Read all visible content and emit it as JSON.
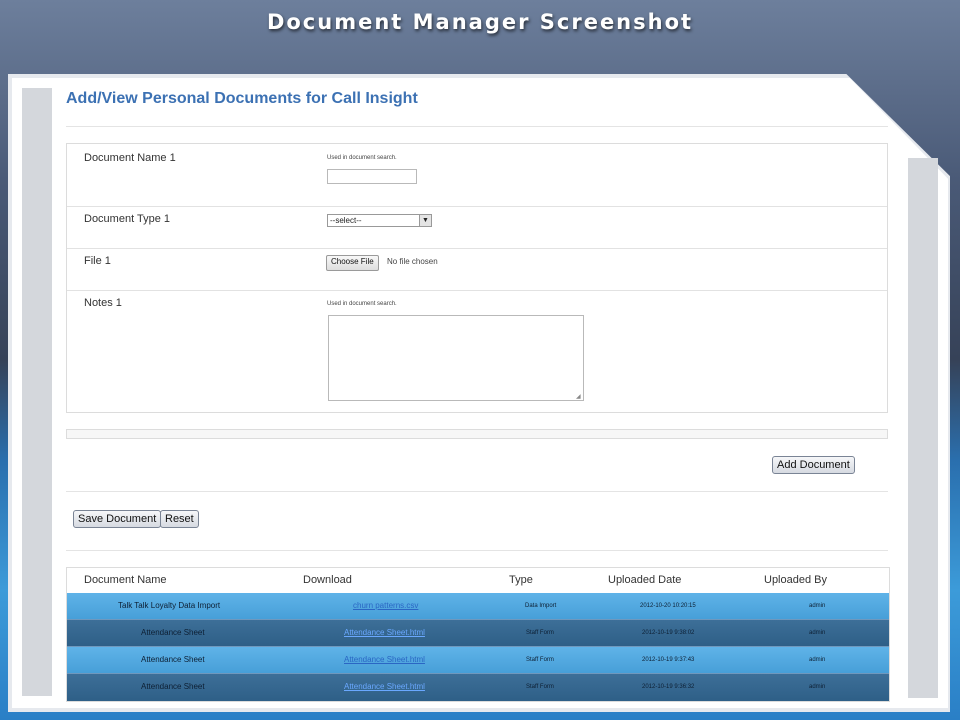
{
  "slide": {
    "title": "Document Manager Screenshot"
  },
  "page": {
    "heading": "Add/View Personal Documents for Call Insight"
  },
  "form": {
    "document_name": {
      "label": "Document Name 1",
      "hint": "Used in document search.",
      "value": ""
    },
    "document_type": {
      "label": "Document Type 1",
      "selected": "--select--"
    },
    "file": {
      "label": "File 1",
      "button_label": "Choose File",
      "status": "No file chosen"
    },
    "notes": {
      "label": "Notes 1",
      "hint": "Used in document search.",
      "value": ""
    }
  },
  "actions": {
    "add_document": "Add Document",
    "save_document": "Save Document",
    "reset": "Reset"
  },
  "table": {
    "headers": [
      "Document Name",
      "Download",
      "Type",
      "Uploaded Date",
      "Uploaded By"
    ],
    "rows": [
      {
        "name": "Talk Talk Loyalty Data Import",
        "download": "churn patterns.csv",
        "type": "Data Import",
        "date": "2012-10-20 10:20:15",
        "by": "admin"
      },
      {
        "name": "Attendance Sheet",
        "download": "Attendance Sheet.html",
        "type": "Staff Form",
        "date": "2012-10-19 9:38:02",
        "by": "admin"
      },
      {
        "name": "Attendance Sheet",
        "download": "Attendance Sheet.html",
        "type": "Staff Form",
        "date": "2012-10-19 9:37:43",
        "by": "admin"
      },
      {
        "name": "Attendance Sheet",
        "download": "Attendance Sheet.html",
        "type": "Staff Form",
        "date": "2012-10-19 9:36:32",
        "by": "admin"
      }
    ]
  },
  "colors": {
    "heading": "#3c71b3",
    "row_light": "#5fb3e8",
    "row_dark": "#3d6f98",
    "link": "#2a66c4"
  },
  "icons": {
    "select_arrow": "chevron-down-icon",
    "resize_grip": "resize-grip-icon"
  }
}
